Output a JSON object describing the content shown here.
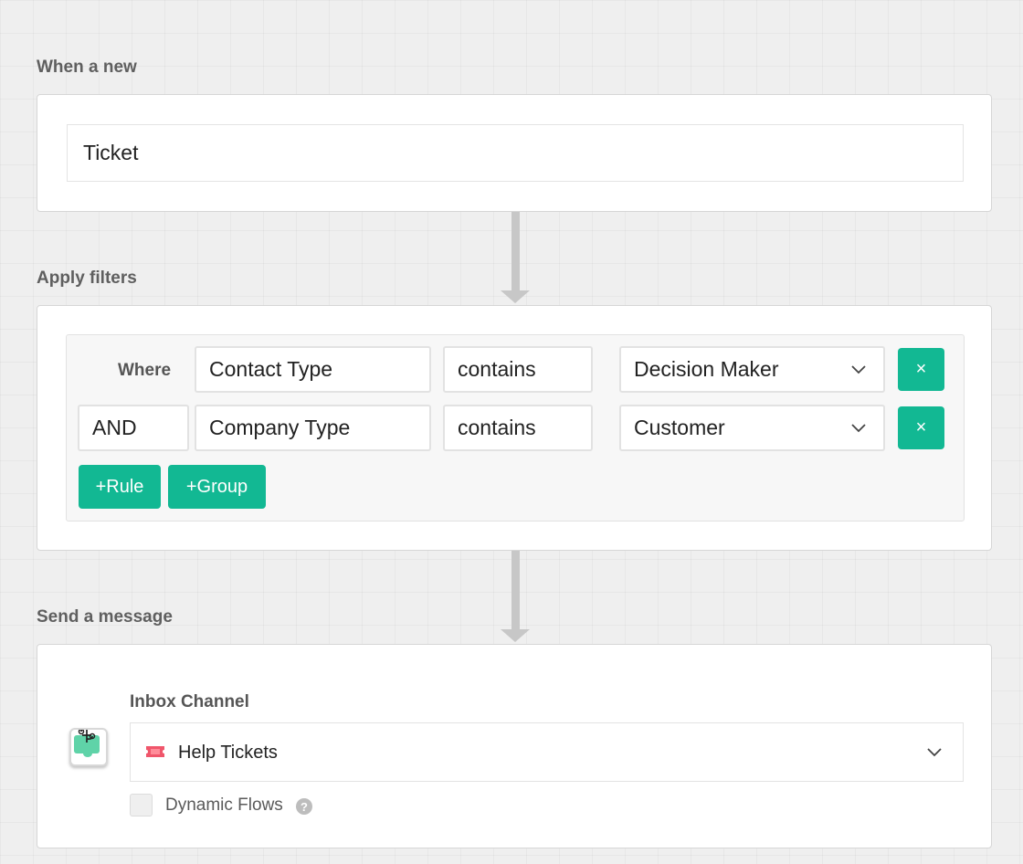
{
  "trigger": {
    "title": "When a new",
    "value": "Ticket"
  },
  "filters": {
    "title": "Apply filters",
    "where_label": "Where",
    "rows": [
      {
        "field": "Contact Type",
        "operator": "contains",
        "value": "Decision Maker",
        "remove_label": "×"
      },
      {
        "conjunction": "AND",
        "field": "Company Type",
        "operator": "contains",
        "value": "Customer",
        "remove_label": "×"
      }
    ],
    "add_rule_label": "+Rule",
    "add_group_label": "+Group"
  },
  "message": {
    "title": "Send a message",
    "channel_label": "Inbox Channel",
    "channel_value": "Help Tickets",
    "channel_icon": "ticket-icon",
    "app_icon": "workflow-app-icon",
    "dynamic_flows_label": "Dynamic Flows",
    "dynamic_flows_checked": false,
    "help_icon": "question-icon"
  },
  "colors": {
    "accent": "#12b893",
    "background": "#efefef",
    "ticket_icon": "#f0566b"
  }
}
